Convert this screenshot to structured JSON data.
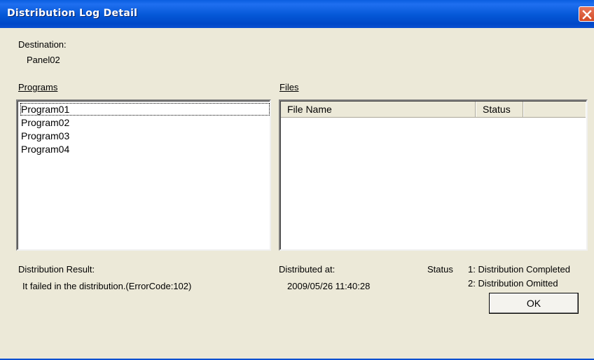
{
  "window": {
    "title": "Distribution Log Detail",
    "close_icon": "close-icon"
  },
  "destination": {
    "label": "Destination:",
    "value": "Panel02"
  },
  "programs": {
    "label": "Programs",
    "items": [
      "Program01",
      "Program02",
      "Program03",
      "Program04"
    ]
  },
  "files": {
    "label": "Files",
    "columns": [
      "File Name",
      "Status"
    ],
    "rows": []
  },
  "result": {
    "label": "Distribution Result:",
    "value": "It failed in the distribution.(ErrorCode:102)"
  },
  "distributed": {
    "label": "Distributed at:",
    "value": "2009/05/26 11:40:28"
  },
  "status_legend": {
    "label": "Status",
    "items": [
      "1: Distribution Completed",
      "2: Distribution Omitted"
    ]
  },
  "buttons": {
    "ok": "OK"
  },
  "colors": {
    "title_bar": "#0054e3",
    "dialog_bg": "#ece9d8",
    "close_button": "#e25a38"
  }
}
